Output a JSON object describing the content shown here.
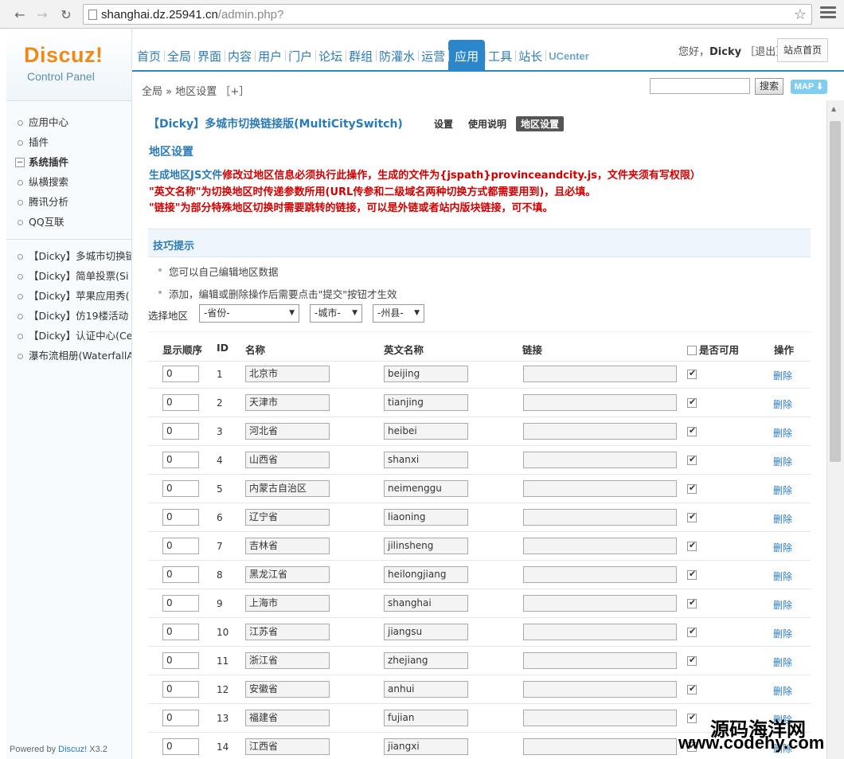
{
  "browser": {
    "url_host": "shanghai.dz.25941.cn",
    "url_path": "/admin.php?"
  },
  "header": {
    "logo_main": "Discuz!",
    "logo_sub": "Control Panel",
    "nav": [
      "首页",
      "全局",
      "界面",
      "内容",
      "用户",
      "门户",
      "论坛",
      "群组",
      "防灌水",
      "运营",
      "应用",
      "工具",
      "站长",
      "UCenter"
    ],
    "active_nav": "应用",
    "greeting_prefix": "您好，",
    "username": "Dicky",
    "logout": "［退出］",
    "site_home": "站点首页",
    "breadcrumb": "全局 » 地区设置 ［+］",
    "search_button": "搜索",
    "map_button": "MAP ⬇"
  },
  "sidebar": {
    "group1": [
      "应用中心",
      "插件"
    ],
    "group_system_title": "系统插件",
    "group2": [
      "纵横搜索",
      "腾讯分析",
      "QQ互联"
    ],
    "group3": [
      "【Dicky】多城市切换链",
      "【Dicky】简单投票(Si",
      "【Dicky】苹果应用秀(",
      "【Dicky】仿19楼活动",
      "【Dicky】认证中心(Ce",
      "瀑布流相册(WaterfallA"
    ],
    "powered_prefix": "Powered by ",
    "powered_brand": "Discuz!",
    "powered_version": " X3.2"
  },
  "main": {
    "plugin_title": "【Dicky】多城市切换链接版(MultiCitySwitch)",
    "tabs": [
      "设置",
      "使用说明",
      "地区设置"
    ],
    "active_tab": "地区设置",
    "section_title": "地区设置",
    "warn1_link": "生成地区JS文件",
    "warn1_rest": "修改过地区信息必须执行此操作，生成的文件为{jspath}provinceandcity.js，文件夹须有写权限）",
    "warn2": "\"英文名称\"为切换地区时传递参数所用(URL传参和二级域名两种切换方式都需要用到)，且必填。",
    "warn3": "\"链接\"为部分特殊地区切换时需要跳转的链接，可以是外链或者站内版块链接，可不填。",
    "tips_title": "技巧提示",
    "tips": [
      "您可以自己编辑地区数据",
      "添加，编辑或删除操作后需要点击\"提交\"按钮才生效"
    ],
    "region_label": "选择地区",
    "selects": [
      "-省份-",
      "-城市-",
      "-州县-"
    ],
    "columns": {
      "order": "显示顺序",
      "id": "ID",
      "name": "名称",
      "ename": "英文名称",
      "link": "链接",
      "enabled": "是否可用",
      "action": "操作"
    },
    "rows": [
      {
        "order": "0",
        "id": "1",
        "name": "北京市",
        "ename": "beijing",
        "link": "",
        "enabled": true,
        "action": "删除"
      },
      {
        "order": "0",
        "id": "2",
        "name": "天津市",
        "ename": "tianjing",
        "link": "",
        "enabled": true,
        "action": "删除"
      },
      {
        "order": "0",
        "id": "3",
        "name": "河北省",
        "ename": "heibei",
        "link": "",
        "enabled": true,
        "action": "删除"
      },
      {
        "order": "0",
        "id": "4",
        "name": "山西省",
        "ename": "shanxi",
        "link": "",
        "enabled": true,
        "action": "删除"
      },
      {
        "order": "0",
        "id": "5",
        "name": "内蒙古自治区",
        "ename": "neimenggu",
        "link": "",
        "enabled": true,
        "action": "删除"
      },
      {
        "order": "0",
        "id": "6",
        "name": "辽宁省",
        "ename": "liaoning",
        "link": "",
        "enabled": true,
        "action": "删除"
      },
      {
        "order": "0",
        "id": "7",
        "name": "吉林省",
        "ename": "jilinsheng",
        "link": "",
        "enabled": true,
        "action": "删除"
      },
      {
        "order": "0",
        "id": "8",
        "name": "黑龙江省",
        "ename": "heilongjiang",
        "link": "",
        "enabled": true,
        "action": "删除"
      },
      {
        "order": "0",
        "id": "9",
        "name": "上海市",
        "ename": "shanghai",
        "link": "",
        "enabled": true,
        "action": "删除"
      },
      {
        "order": "0",
        "id": "10",
        "name": "江苏省",
        "ename": "jiangsu",
        "link": "",
        "enabled": true,
        "action": "删除"
      },
      {
        "order": "0",
        "id": "11",
        "name": "浙江省",
        "ename": "zhejiang",
        "link": "",
        "enabled": true,
        "action": "删除"
      },
      {
        "order": "0",
        "id": "12",
        "name": "安徽省",
        "ename": "anhui",
        "link": "",
        "enabled": true,
        "action": "删除"
      },
      {
        "order": "0",
        "id": "13",
        "name": "福建省",
        "ename": "fujian",
        "link": "",
        "enabled": true,
        "action": "删除"
      },
      {
        "order": "0",
        "id": "14",
        "name": "江西省",
        "ename": "jiangxi",
        "link": "",
        "enabled": true,
        "action": "删除"
      }
    ]
  },
  "watermark": {
    "line1": "源码海洋网",
    "line2": "www.codehy.com"
  }
}
